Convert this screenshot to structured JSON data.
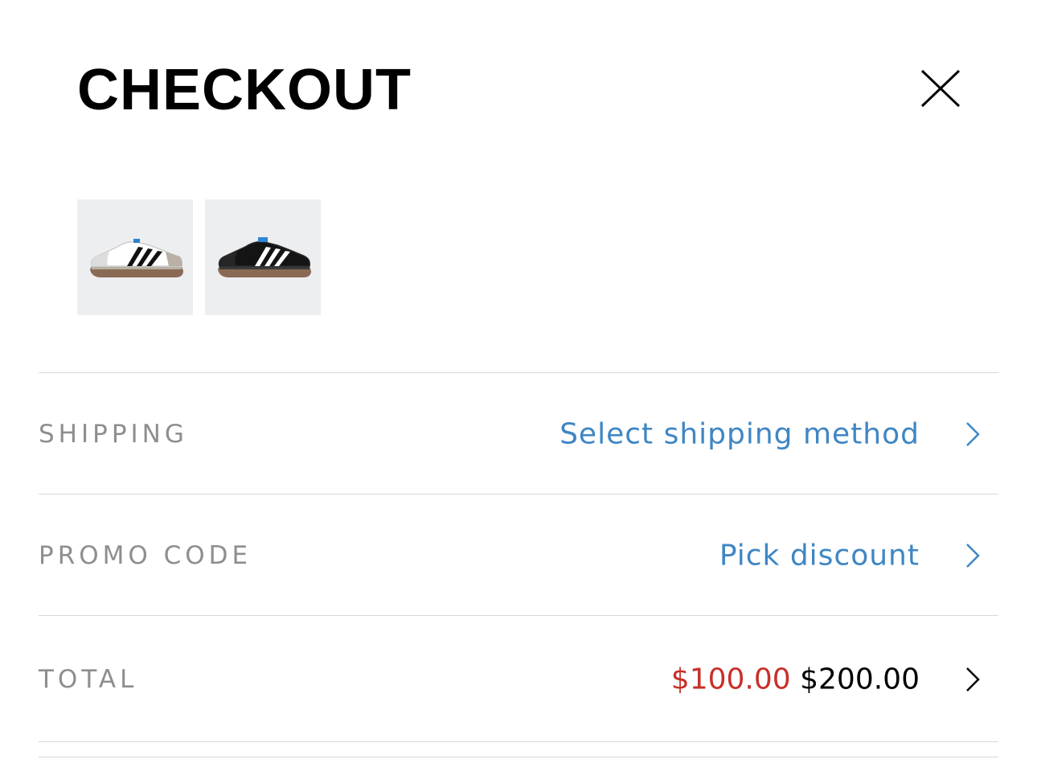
{
  "header": {
    "title": "CHECKOUT",
    "close_icon": "close-icon"
  },
  "products": [
    {
      "name": "white-sneaker",
      "colors": {
        "upper": "#ffffff",
        "stripes": "#111111",
        "sole": "#8a6a55"
      }
    },
    {
      "name": "black-sneaker",
      "colors": {
        "upper": "#111111",
        "stripes": "#ffffff",
        "sole": "#8a6a55"
      }
    }
  ],
  "rows": {
    "shipping": {
      "label": "SHIPPING",
      "value": "Select shipping method",
      "icon": "chevron-right-icon"
    },
    "promo": {
      "label": "PROMO CODE",
      "value": "Pick discount",
      "icon": "chevron-right-icon"
    },
    "total": {
      "label": "TOTAL",
      "discounted_price": "$100.00",
      "original_price": "$200.00",
      "icon": "chevron-right-icon"
    }
  },
  "colors": {
    "accent": "#3f86c4",
    "sale": "#c8302a",
    "label": "#8e8e8e",
    "divider": "#d8d8d8"
  }
}
